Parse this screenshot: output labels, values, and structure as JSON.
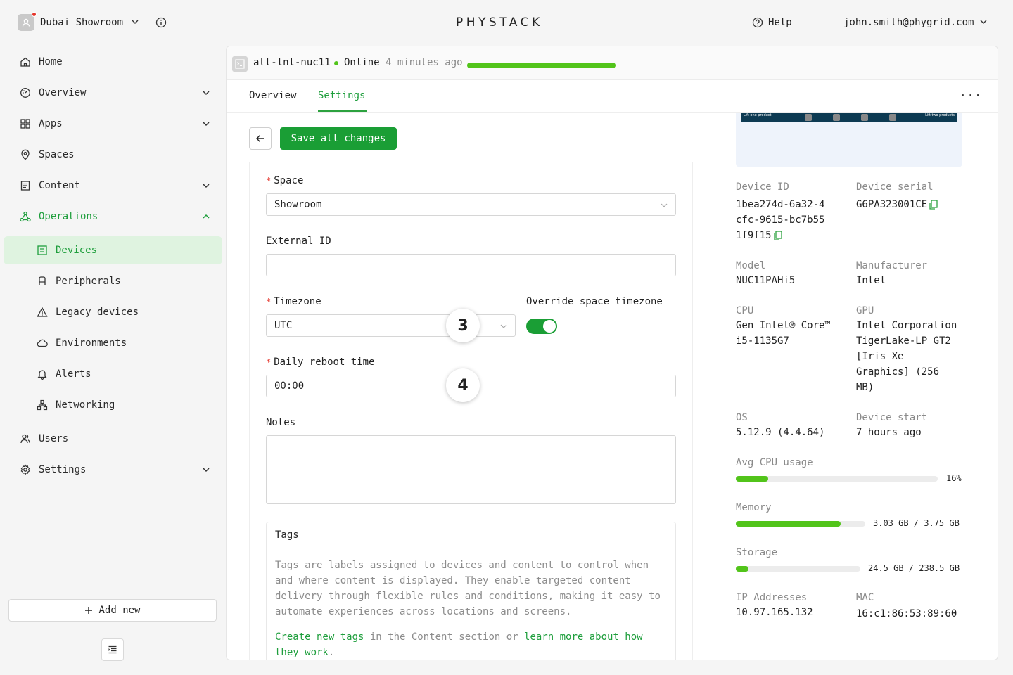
{
  "topbar": {
    "workspace": "Dubai Showroom",
    "logo": "PHYSTACK",
    "help": "Help",
    "user": "john.smith@phygrid.com"
  },
  "sidebar": {
    "items": [
      {
        "label": "Home",
        "icon": "home-icon"
      },
      {
        "label": "Overview",
        "icon": "dashboard-icon"
      },
      {
        "label": "Apps",
        "icon": "apps-grid-icon"
      },
      {
        "label": "Spaces",
        "icon": "location-pin-icon"
      },
      {
        "label": "Content",
        "icon": "content-icon"
      },
      {
        "label": "Operations",
        "icon": "operations-icon"
      }
    ],
    "operations_sub": [
      {
        "label": "Devices",
        "icon": "device-icon"
      },
      {
        "label": "Peripherals",
        "icon": "peripheral-icon"
      },
      {
        "label": "Legacy devices",
        "icon": "warning-icon"
      },
      {
        "label": "Environments",
        "icon": "cloud-icon"
      },
      {
        "label": "Alerts",
        "icon": "bell-icon"
      },
      {
        "label": "Networking",
        "icon": "network-icon"
      }
    ],
    "bottom_items": [
      {
        "label": "Users",
        "icon": "users-icon"
      },
      {
        "label": "Settings",
        "icon": "gear-icon"
      }
    ],
    "add_new": "Add new",
    "active_color": "#1e9e3c"
  },
  "device": {
    "name": "att-lnl-nuc11",
    "status": "Online",
    "last_seen": "4 minutes ago",
    "status_color": "#52c41a"
  },
  "tabs": [
    "Overview",
    "Settings"
  ],
  "active_tab": "Settings",
  "actions": {
    "save": "Save all changes"
  },
  "form": {
    "space_label": "Space",
    "space_value": "Showroom",
    "external_id_label": "External ID",
    "external_id_value": "",
    "timezone_label": "Timezone",
    "timezone_value": "UTC",
    "override_label": "Override space timezone",
    "override_on": true,
    "reboot_label": "Daily reboot time",
    "reboot_value": "00:00",
    "notes_label": "Notes",
    "notes_value": "",
    "markers": [
      "3",
      "4"
    ]
  },
  "tags": {
    "title": "Tags",
    "description": "Tags are labels assigned to devices and content to control when and where content is displayed. They enable targeted content delivery through flexible rules and conditions, making it easy to automate experiences across locations and screens.",
    "link1": "Create new tags",
    "mid_text": " in the Content section or ",
    "link2": "learn more about how they work",
    "end_text": "."
  },
  "info": {
    "preview_left": "Lift one product",
    "preview_right": "Lift two products",
    "device_id_label": "Device ID",
    "device_id": "1bea274d-6a32-4cfc-9615-bc7b551f9f15",
    "serial_label": "Device serial",
    "serial": "G6PA323001CE",
    "model_label": "Model",
    "model": "NUC11PAHi5",
    "manufacturer_label": "Manufacturer",
    "manufacturer": "Intel",
    "cpu_label": "CPU",
    "cpu": "Gen Intel® Core™ i5-1135G7",
    "gpu_label": "GPU",
    "gpu": "Intel Corporation TigerLake-LP GT2 [Iris Xe Graphics] (256 MB)",
    "os_label": "OS",
    "os": "5.12.9 (4.4.64)",
    "start_label": "Device start",
    "start": "7 hours ago",
    "cpu_usage_label": "Avg CPU usage",
    "cpu_usage_text": "16%",
    "cpu_usage_fraction": 0.16,
    "memory_label": "Memory",
    "memory_text": "3.03 GB / 3.75 GB",
    "memory_fraction": 0.81,
    "storage_label": "Storage",
    "storage_text": "24.5 GB / 238.5 GB",
    "storage_fraction": 0.1,
    "ip_label": "IP Addresses",
    "ip": "10.97.165.132",
    "mac_label": "MAC",
    "mac": "16:c1:86:53:89:60"
  }
}
